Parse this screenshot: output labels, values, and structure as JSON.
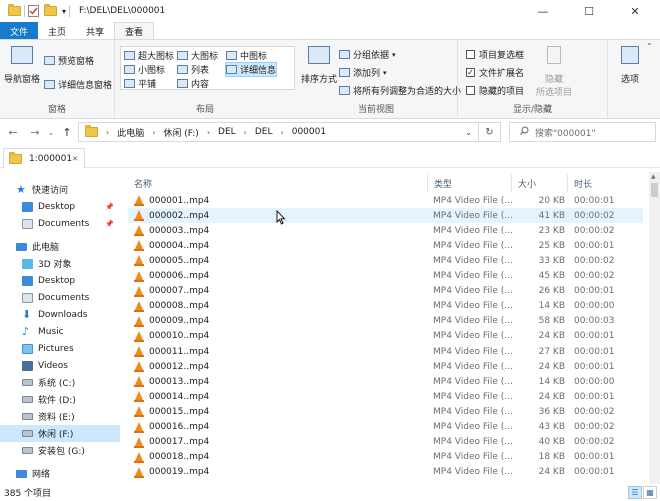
{
  "window": {
    "title": "F:\\DEL\\DEL\\000001",
    "minimize": "—",
    "maximize": "☐",
    "close": "✕",
    "quick_access_dropdown": "▾"
  },
  "ribbon_tabs": [
    "文件",
    "主页",
    "共享",
    "查看"
  ],
  "ribbon": {
    "panes": {
      "nav_pane": "导航窗格",
      "preview": "预览窗格",
      "details": "详细信息窗格",
      "label": "窗格"
    },
    "layout": {
      "items": [
        "超大图标",
        "大图标",
        "中图标",
        "小图标",
        "列表",
        "详细信息",
        "平铺",
        "内容"
      ],
      "label": "布局"
    },
    "current_view": {
      "sort": "排序方式",
      "group": "分组依据",
      "add_column": "添加列",
      "fit_columns": "将所有列调整为合适的大小",
      "label": "当前视图"
    },
    "show_hide": {
      "item_checkboxes": "项目复选框",
      "item_checkboxes_checked": false,
      "file_ext": "文件扩展名",
      "file_ext_checked": true,
      "hidden_items": "隐藏的项目",
      "hidden_items_checked": false,
      "hide_selected_1": "隐藏",
      "hide_selected_2": "所选项目",
      "options": "选项",
      "label": "显示/隐藏"
    }
  },
  "nav_buttons": {
    "back": "←",
    "forward": "→",
    "dropdown": "⌄",
    "up": "↑",
    "refresh": "↻",
    "addr_dropdown": "⌄"
  },
  "breadcrumb": [
    "此电脑",
    "休闲 (F:)",
    "DEL",
    "DEL",
    "000001"
  ],
  "search": {
    "placeholder": "搜索\"000001\""
  },
  "folder_tab": {
    "label": "1:000001"
  },
  "nav_pane": {
    "quick_access": "快速访问",
    "this_pc": "此电脑",
    "network": "网络",
    "items": [
      {
        "label": "Desktop",
        "pinned": true
      },
      {
        "label": "Documents",
        "pinned": true
      },
      {
        "label": "3D 对象"
      },
      {
        "label": "Desktop"
      },
      {
        "label": "Documents"
      },
      {
        "label": "Downloads"
      },
      {
        "label": "Music"
      },
      {
        "label": "Pictures"
      },
      {
        "label": "Videos"
      },
      {
        "label": "系统 (C:)"
      },
      {
        "label": "软件 (D:)"
      },
      {
        "label": "资料 (E:)"
      },
      {
        "label": "休闲 (F:)"
      },
      {
        "label": "安装包 (G:)"
      }
    ]
  },
  "columns": {
    "name": "名称",
    "type": "类型",
    "size": "大小",
    "duration": "时长"
  },
  "files": [
    {
      "name": "000001..mp4",
      "type": "MP4 Video File (...",
      "size": "20 KB",
      "duration": "00:00:01"
    },
    {
      "name": "000002..mp4",
      "type": "MP4 Video File (...",
      "size": "41 KB",
      "duration": "00:00:02"
    },
    {
      "name": "000003..mp4",
      "type": "MP4 Video File (...",
      "size": "23 KB",
      "duration": "00:00:02"
    },
    {
      "name": "000004..mp4",
      "type": "MP4 Video File (...",
      "size": "25 KB",
      "duration": "00:00:01"
    },
    {
      "name": "000005..mp4",
      "type": "MP4 Video File (...",
      "size": "33 KB",
      "duration": "00:00:02"
    },
    {
      "name": "000006..mp4",
      "type": "MP4 Video File (...",
      "size": "45 KB",
      "duration": "00:00:02"
    },
    {
      "name": "000007..mp4",
      "type": "MP4 Video File (...",
      "size": "26 KB",
      "duration": "00:00:01"
    },
    {
      "name": "000008..mp4",
      "type": "MP4 Video File (...",
      "size": "14 KB",
      "duration": "00:00:00"
    },
    {
      "name": "000009..mp4",
      "type": "MP4 Video File (...",
      "size": "58 KB",
      "duration": "00:00:03"
    },
    {
      "name": "000010..mp4",
      "type": "MP4 Video File (...",
      "size": "24 KB",
      "duration": "00:00:01"
    },
    {
      "name": "000011..mp4",
      "type": "MP4 Video File (...",
      "size": "27 KB",
      "duration": "00:00:01"
    },
    {
      "name": "000012..mp4",
      "type": "MP4 Video File (...",
      "size": "24 KB",
      "duration": "00:00:01"
    },
    {
      "name": "000013..mp4",
      "type": "MP4 Video File (...",
      "size": "14 KB",
      "duration": "00:00:00"
    },
    {
      "name": "000014..mp4",
      "type": "MP4 Video File (...",
      "size": "24 KB",
      "duration": "00:00:01"
    },
    {
      "name": "000015..mp4",
      "type": "MP4 Video File (...",
      "size": "36 KB",
      "duration": "00:00:02"
    },
    {
      "name": "000016..mp4",
      "type": "MP4 Video File (...",
      "size": "43 KB",
      "duration": "00:00:02"
    },
    {
      "name": "000017..mp4",
      "type": "MP4 Video File (...",
      "size": "40 KB",
      "duration": "00:00:02"
    },
    {
      "name": "000018..mp4",
      "type": "MP4 Video File (...",
      "size": "18 KB",
      "duration": "00:00:01"
    },
    {
      "name": "000019..mp4",
      "type": "MP4 Video File (...",
      "size": "24 KB",
      "duration": "00:00:01"
    }
  ],
  "status": {
    "count": "385 个项目"
  },
  "colors": {
    "accent": "#1979ca",
    "selection": "#cce8ff",
    "hover": "#e5f3ff",
    "vlc_orange": "#f08a18",
    "folder": "#f0c64a"
  }
}
